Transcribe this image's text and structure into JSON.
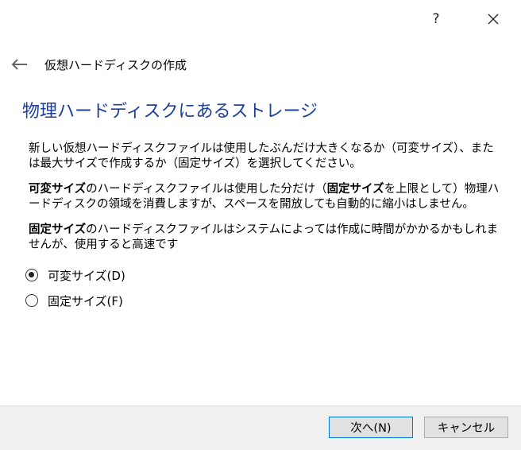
{
  "titlebar": {
    "help_label": "?",
    "close_icon": "close-icon"
  },
  "nav": {
    "back_icon": "back-arrow-icon",
    "title": "仮想ハードディスクの作成"
  },
  "heading": "物理ハードディスクにあるストレージ",
  "paragraphs": {
    "p1": "新しい仮想ハードディスクファイルは使用したぶんだけ大きくなるか（可変サイズ）、または最大サイズで作成するか（固定サイズ）を選択してください。",
    "p2_bold1": "可変サイズ",
    "p2_text1": "のハードディスクファイルは使用した分だけ（",
    "p2_bold2": "固定サイズ",
    "p2_text2": "を上限として）物理ハードディスクの領域を消費しますが、スペースを開放しても自動的に縮小はしません。",
    "p3_bold": "固定サイズ",
    "p3_text": "のハードディスクファイルはシステムによっては作成に時間がかかるかもしれませんが、使用すると高速です"
  },
  "options": {
    "dynamic_label": "可変サイズ(D)",
    "fixed_label": "固定サイズ(F)",
    "selected": "dynamic"
  },
  "buttons": {
    "next_label": "次へ(N)",
    "cancel_label": "キャンセル"
  },
  "colors": {
    "heading": "#1e3f9a",
    "accent": "#0078d7",
    "footer_bg": "#f0f0f0"
  }
}
